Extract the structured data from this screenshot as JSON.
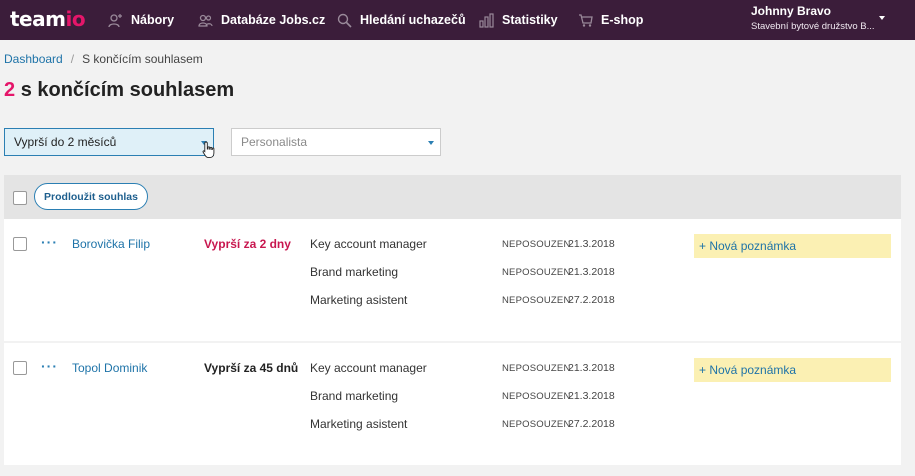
{
  "app": {
    "logo_main": "team",
    "logo_accent": "io"
  },
  "nav": {
    "items": [
      {
        "label": "Nábory",
        "icon": "recruitment-icon"
      },
      {
        "label": "Databáze Jobs.cz",
        "icon": "database-people-icon"
      },
      {
        "label": "Hledání uchazečů",
        "icon": "search-candidates-icon"
      },
      {
        "label": "Statistiky",
        "icon": "bar-chart-icon"
      },
      {
        "label": "E-shop",
        "icon": "cart-icon"
      }
    ]
  },
  "user": {
    "name": "Johnny Bravo",
    "organization": "Stavební bytové družstvo B..."
  },
  "breadcrumb": {
    "home": "Dashboard",
    "separator": "/",
    "current": "S končícím souhlasem"
  },
  "header": {
    "count": "2",
    "title": "s končícím souhlasem"
  },
  "filters": {
    "expiry_value": "Vyprší do 2 měsíců",
    "recruiter_placeholder": "Personalista"
  },
  "toolbar": {
    "extend_label": "Prodloužit souhlas"
  },
  "candidates": [
    {
      "name": "Borovička Filip",
      "expiry": "Vyprší za 2 dny",
      "urgent": true,
      "note_label": "+ Nová poznámka",
      "jobs": [
        {
          "title": "Key account manager",
          "status": "NEPOSOUZEN",
          "date": "21.3.2018"
        },
        {
          "title": "Brand marketing",
          "status": "NEPOSOUZEN",
          "date": "21.3.2018"
        },
        {
          "title": "Marketing asistent",
          "status": "NEPOSOUZEN",
          "date": "27.2.2018"
        }
      ]
    },
    {
      "name": "Topol Dominik",
      "expiry": "Vyprší za 45 dnů",
      "urgent": false,
      "note_label": "+ Nová poznámka",
      "jobs": [
        {
          "title": "Key account manager",
          "status": "NEPOSOUZEN",
          "date": "21.3.2018"
        },
        {
          "title": "Brand marketing",
          "status": "NEPOSOUZEN",
          "date": "21.3.2018"
        },
        {
          "title": "Marketing asistent",
          "status": "NEPOSOUZEN",
          "date": "27.2.2018"
        }
      ]
    }
  ],
  "colors": {
    "topbar": "#3b1d3a",
    "accent": "#e5166a",
    "link": "#1e73a8",
    "note_bg": "#fbf0b3"
  }
}
